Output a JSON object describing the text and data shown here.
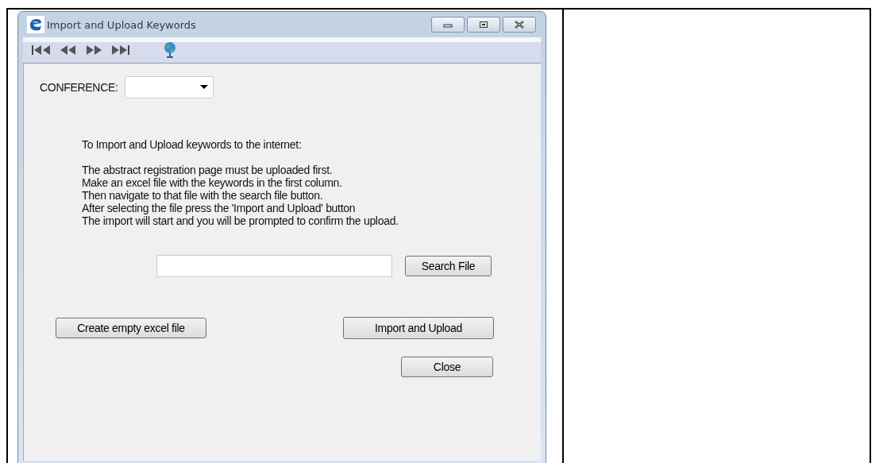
{
  "window": {
    "title": "Import and Upload Keywords"
  },
  "toolbar": [
    {
      "kind": "first"
    },
    {
      "kind": "prev"
    },
    {
      "kind": "next"
    },
    {
      "kind": "last"
    },
    {
      "kind": "globe"
    }
  ],
  "conference": {
    "label": "CONFERENCE:"
  },
  "instructions": {
    "heading": "To Import and Upload keywords to the internet:",
    "lines": [
      "The abstract registration page must be uploaded first.",
      "Make an excel file with the keywords in the first column.",
      "Then navigate to that file with the search file button.",
      "After selecting the file press the 'Import and Upload' button",
      "The import will start and you will be prompted to confirm the upload."
    ]
  },
  "search_button": "Search File",
  "create_button": "Create empty excel file",
  "import_button": "Import and Upload",
  "close_button": "Close"
}
